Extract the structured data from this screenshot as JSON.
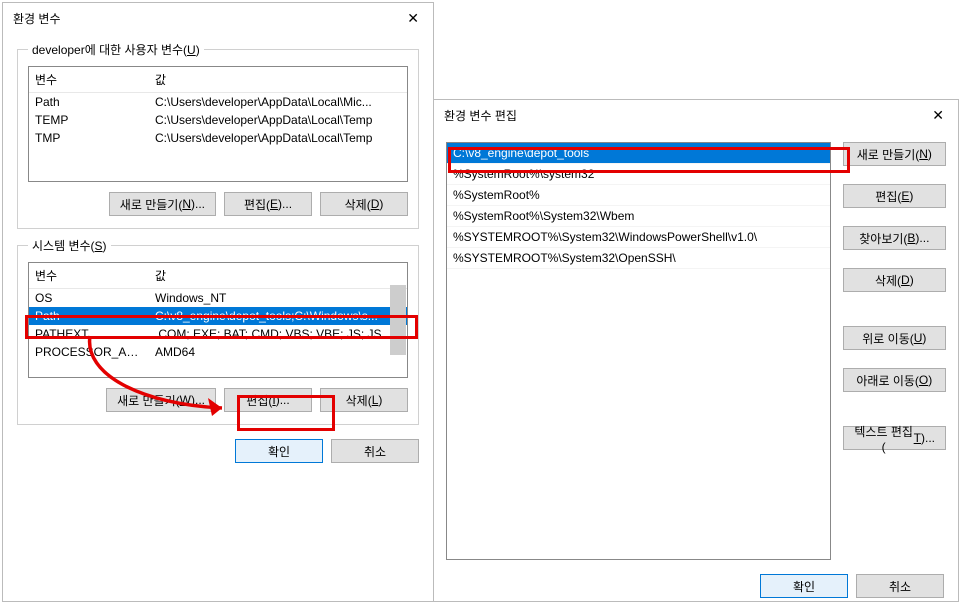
{
  "win1": {
    "title": "환경 변수",
    "userLegendPre": "developer에 대한 사용자 변수(",
    "userLegendKey": "U",
    "userLegendPost": ")",
    "sysLegendPre": "시스템 변수(",
    "sysLegendKey": "S",
    "sysLegendPost": ")",
    "col_var": "변수",
    "col_val": "값",
    "userRows": [
      {
        "name": "Path",
        "val": "C:\\Users\\developer\\AppData\\Local\\Mic..."
      },
      {
        "name": "TEMP",
        "val": "C:\\Users\\developer\\AppData\\Local\\Temp"
      },
      {
        "name": "TMP",
        "val": "C:\\Users\\developer\\AppData\\Local\\Temp"
      }
    ],
    "sysRows": [
      {
        "name": "OS",
        "val": "Windows_NT",
        "sel": false
      },
      {
        "name": "Path",
        "val": "C:\\v8_engine\\depot_tools;C:\\Windows\\s...",
        "sel": true
      },
      {
        "name": "PATHEXT",
        "val": ".COM;.EXE;.BAT;.CMD;.VBS;.VBE;.JS;.JSE;.W...",
        "sel": false
      },
      {
        "name": "PROCESSOR_ARC...",
        "val": "AMD64",
        "sel": false
      }
    ],
    "btn_new": "새로 만들기(N)...",
    "btn_newKey": "N",
    "btn_newW": "새로 만들기(W)...",
    "btn_newWKey": "W",
    "btn_editE": "편집(E)...",
    "btn_editEKey": "E",
    "btn_editI": "편집(I)...",
    "btn_editIKey": "I",
    "btn_delD": "삭제(D)",
    "btn_delDKey": "D",
    "btn_delL": "삭제(L)",
    "btn_delLKey": "L",
    "btn_ok": "확인",
    "btn_cancel": "취소"
  },
  "win2": {
    "title": "환경 변수 편집",
    "items": [
      {
        "text": "C:\\v8_engine\\depot_tools",
        "sel": true
      },
      {
        "text": "%SystemRoot%\\system32",
        "sel": false
      },
      {
        "text": "%SystemRoot%",
        "sel": false
      },
      {
        "text": "%SystemRoot%\\System32\\Wbem",
        "sel": false
      },
      {
        "text": "%SYSTEMROOT%\\System32\\WindowsPowerShell\\v1.0\\",
        "sel": false
      },
      {
        "text": "%SYSTEMROOT%\\System32\\OpenSSH\\",
        "sel": false
      }
    ],
    "btns": {
      "new": "새로 만들기(N)",
      "newKey": "N",
      "edit": "편집(E)",
      "editKey": "E",
      "browse": "찾아보기(B)...",
      "browseKey": "B",
      "del": "삭제(D)",
      "delKey": "D",
      "up": "위로 이동(U)",
      "upKey": "U",
      "down": "아래로 이동(O)",
      "downKey": "O",
      "textedit": "텍스트 편집(T)...",
      "texteditKey": "T"
    },
    "btn_ok": "확인",
    "btn_cancel": "취소"
  }
}
